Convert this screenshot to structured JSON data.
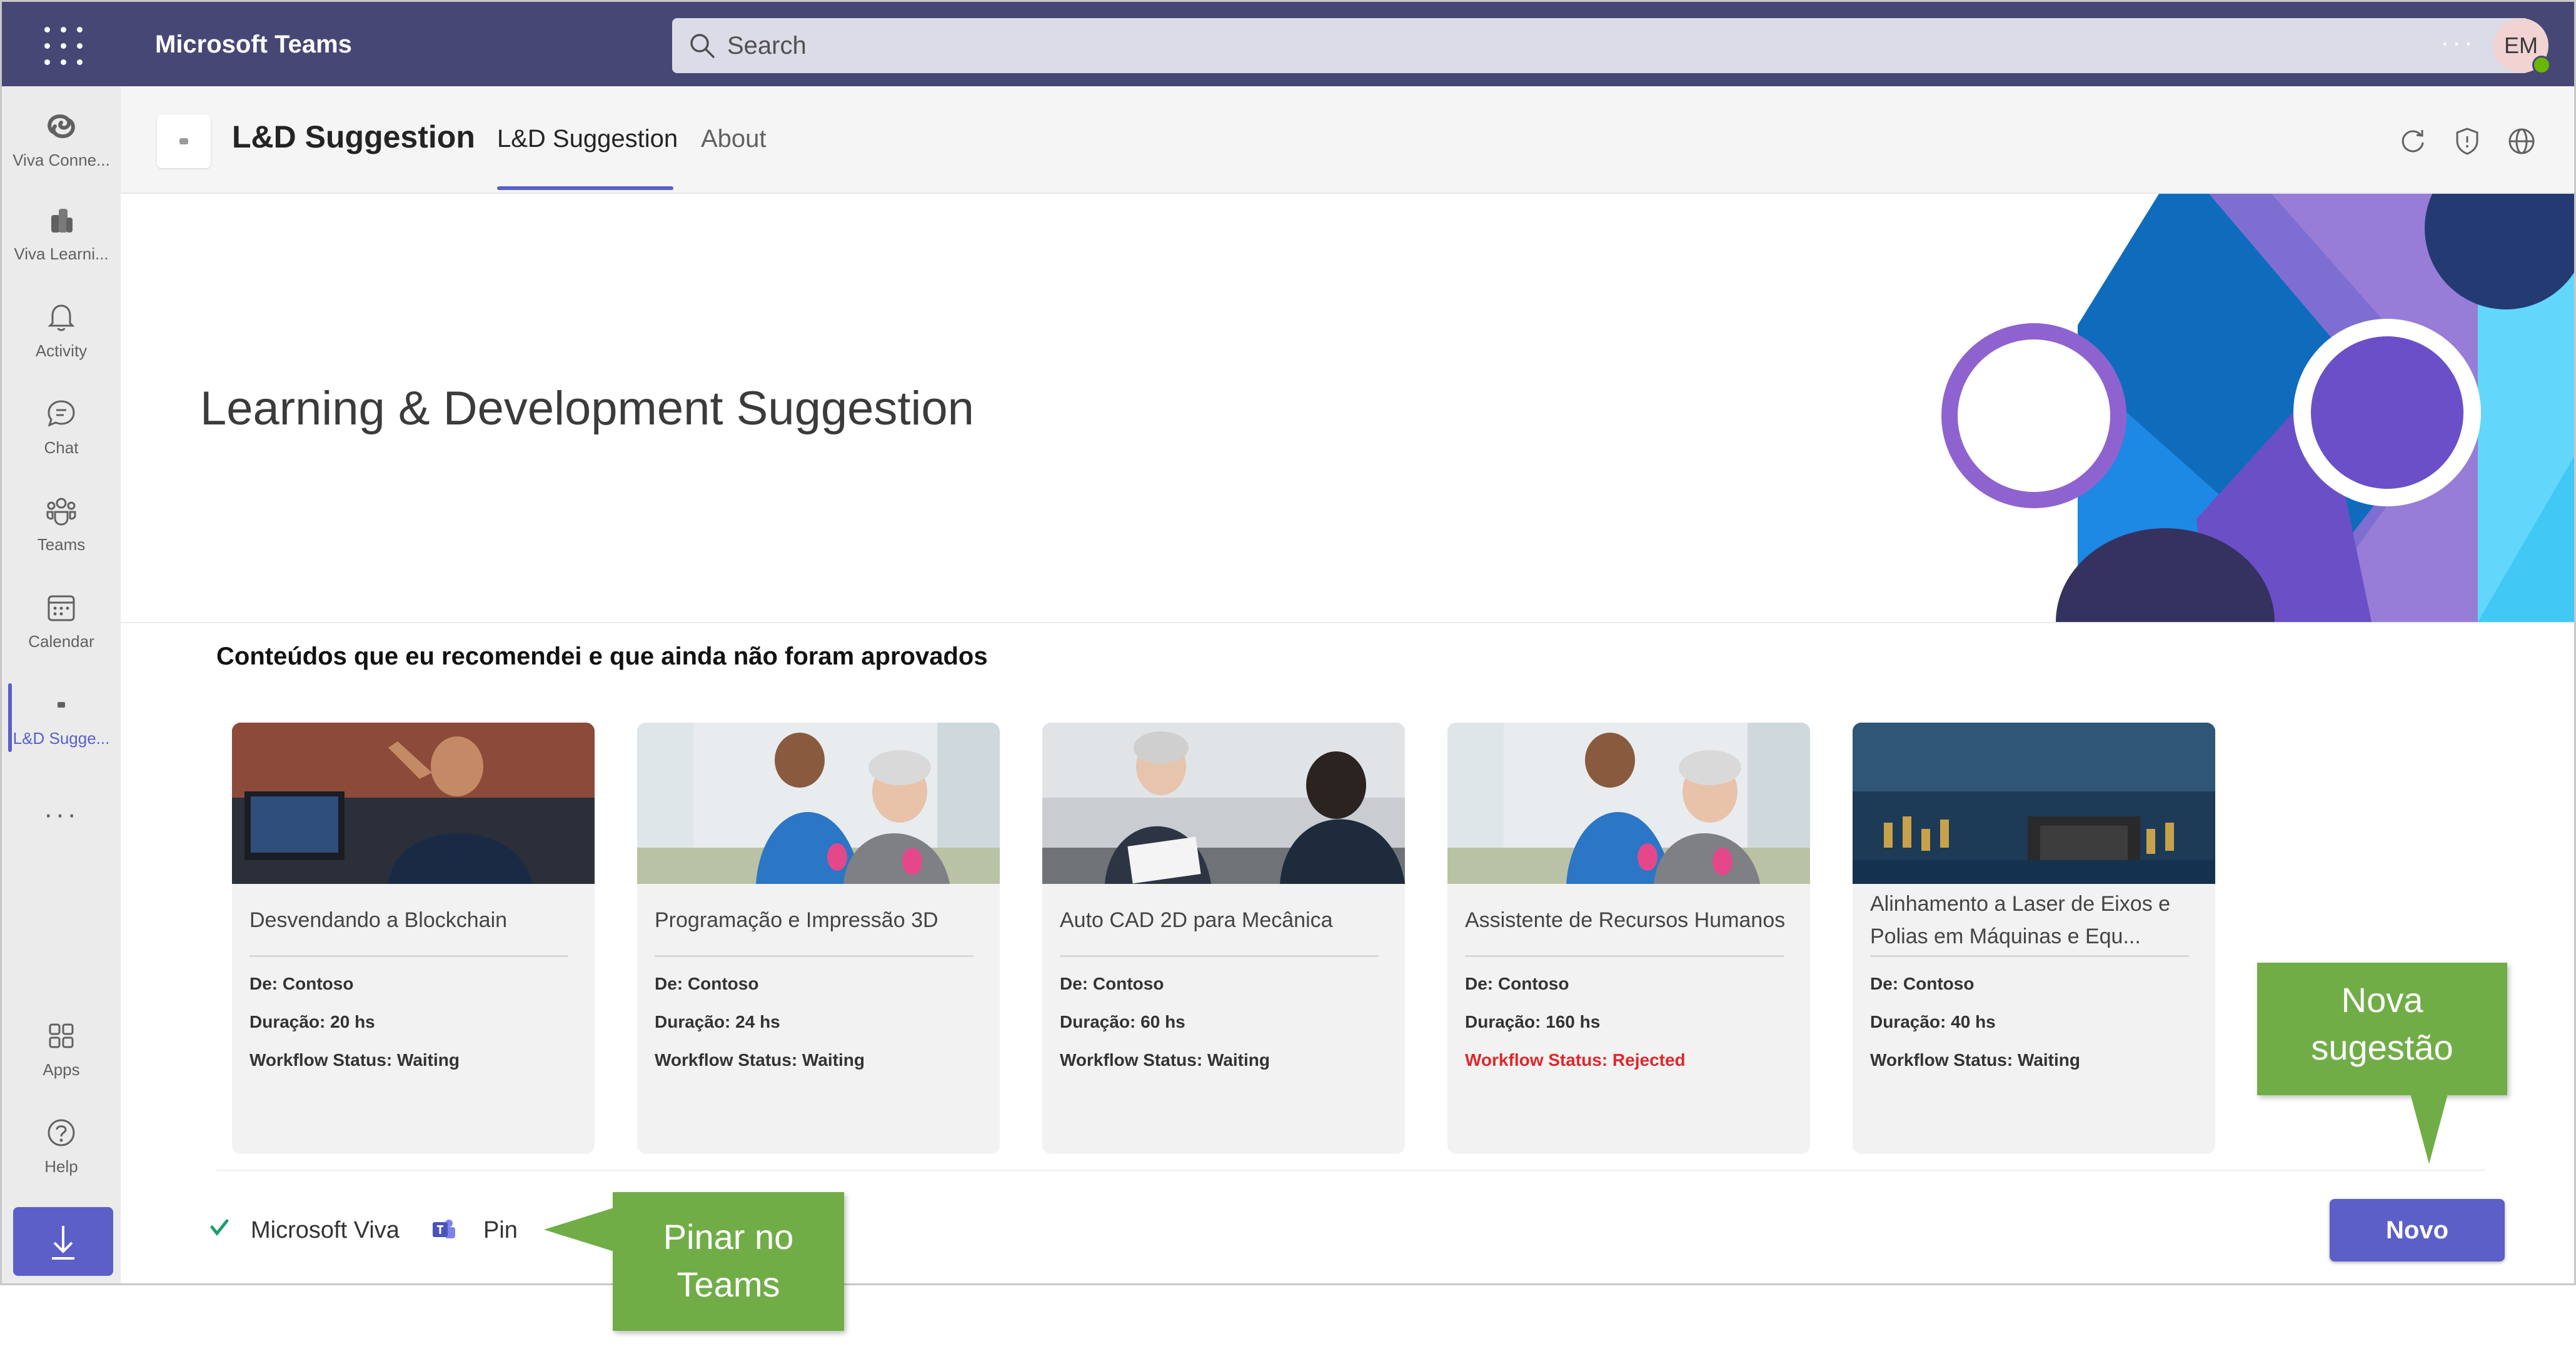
{
  "topbar": {
    "app_title": "Microsoft Teams",
    "search_placeholder": "Search",
    "more_label": "···",
    "avatar_initials": "EM"
  },
  "rail": {
    "items": [
      {
        "label": "Viva Conne...",
        "icon": "viva-connections-icon"
      },
      {
        "label": "Viva Learni...",
        "icon": "viva-learning-icon"
      },
      {
        "label": "Activity",
        "icon": "bell-icon"
      },
      {
        "label": "Chat",
        "icon": "chat-icon"
      },
      {
        "label": "Teams",
        "icon": "teams-icon"
      },
      {
        "label": "Calendar",
        "icon": "calendar-icon"
      },
      {
        "label": "L&D Sugge...",
        "icon": "app-icon",
        "active": true
      }
    ],
    "more_label": "···",
    "apps_label": "Apps",
    "help_label": "Help"
  },
  "app_header": {
    "name": "L&D Suggestion",
    "tabs": [
      {
        "label": "L&D Suggestion",
        "active": true
      },
      {
        "label": "About",
        "active": false
      }
    ],
    "icons": [
      "refresh-icon",
      "shield-icon",
      "globe-icon"
    ]
  },
  "hero": {
    "title": "Learning & Development Suggestion"
  },
  "section": {
    "title": "Conteúdos que eu recomendei e que ainda não foram aprovados"
  },
  "cards": [
    {
      "title": "Desvendando a Blockchain",
      "from": "De: Contoso",
      "duration": "Duração: 20 hs",
      "status": "Workflow Status: Waiting"
    },
    {
      "title": "Programação e Impressão 3D",
      "from": "De: Contoso",
      "duration": "Duração: 24 hs",
      "status": "Workflow Status: Waiting"
    },
    {
      "title": "Auto CAD 2D para Mecânica",
      "from": "De: Contoso",
      "duration": "Duração: 60 hs",
      "status": "Workflow Status: Waiting"
    },
    {
      "title": "Assistente de Recursos Humanos",
      "from": "De: Contoso",
      "duration": "Duração: 160 hs",
      "status": "Workflow Status: Rejected"
    },
    {
      "title": "Alinhamento a Laser de Eixos e Polias em Máquinas e Equ...",
      "from": "De: Contoso",
      "duration": "Duração: 40 hs",
      "status": "Workflow Status: Waiting"
    }
  ],
  "footer": {
    "viva_label": "Microsoft Viva",
    "pin_label": "Pin",
    "new_button": "Novo"
  },
  "callouts": {
    "nova_line1": "Nova",
    "nova_line2": "sugestão",
    "pinar_line1": "Pinar no",
    "pinar_line2": "Teams"
  },
  "colors": {
    "topbar": "#464775",
    "accent": "#5b5fc7",
    "callout": "#70ad47",
    "rejected": "#e0272b"
  }
}
